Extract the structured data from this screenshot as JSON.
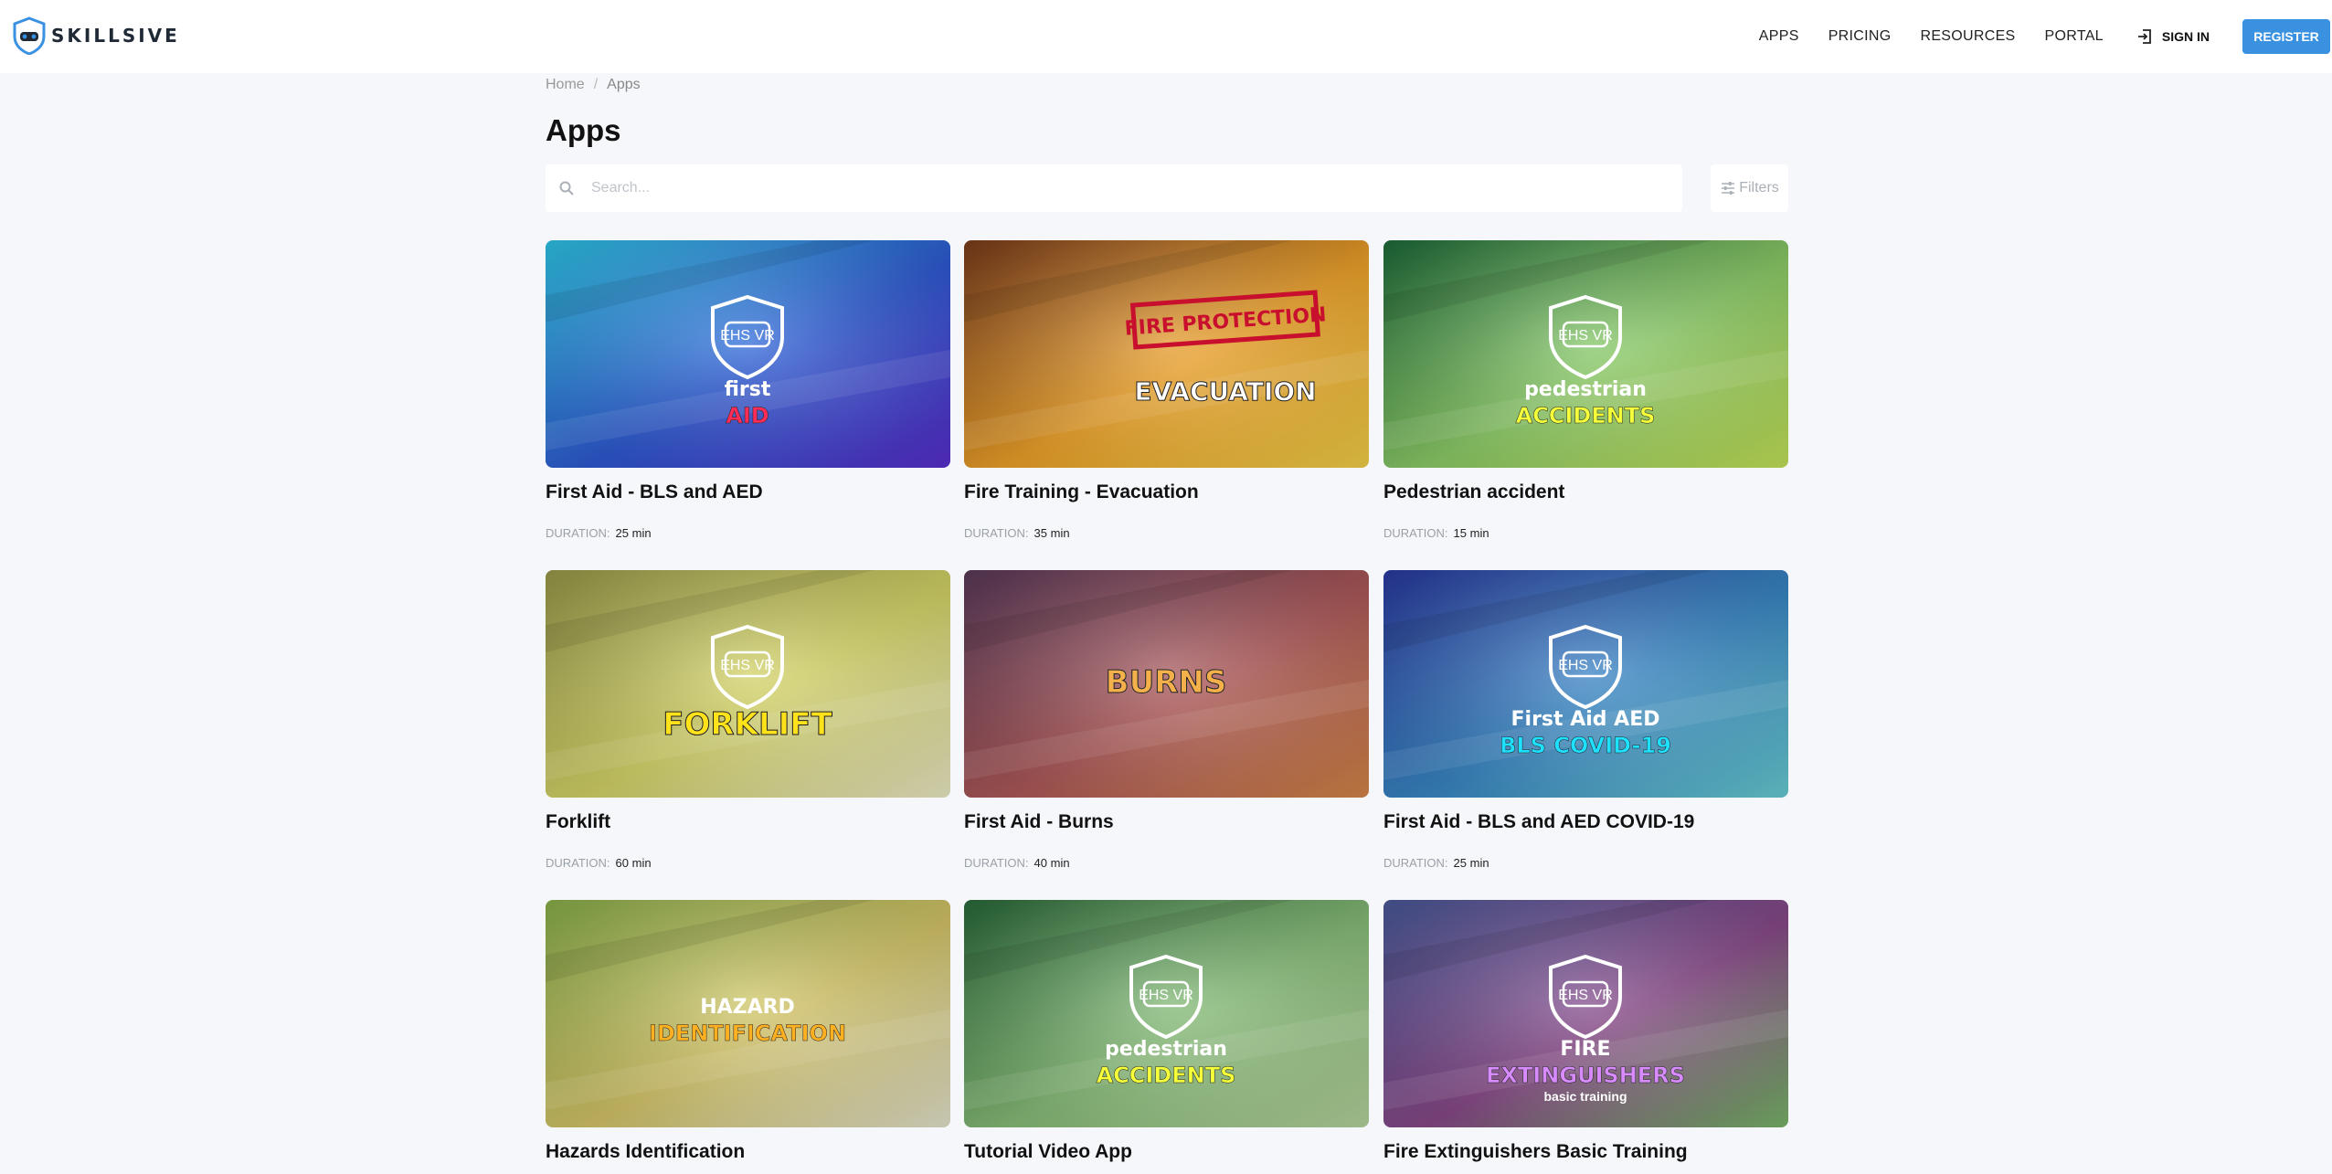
{
  "brand": {
    "name": "SKILLSIVE",
    "accent": "#3a91e0"
  },
  "nav": {
    "items": [
      {
        "label": "APPS"
      },
      {
        "label": "PRICING"
      },
      {
        "label": "RESOURCES"
      },
      {
        "label": "PORTAL"
      }
    ],
    "signin_label": "SIGN IN",
    "register_label": "REGISTER"
  },
  "breadcrumb": {
    "home": "Home",
    "separator": "/",
    "current": "Apps"
  },
  "page": {
    "title": "Apps"
  },
  "search": {
    "placeholder": "Search...",
    "value": ""
  },
  "filters": {
    "label": "Filters"
  },
  "duration_label": "DURATION:",
  "apps": [
    {
      "title": "First Aid - BLS and AED",
      "duration": "25 min",
      "image": {
        "badge": "EHS VR",
        "line1": "first",
        "line2": "AID",
        "palette": [
          "#2ec5e8",
          "#2f5bd6",
          "#5a2fd0"
        ],
        "text_color": "#ff2d55"
      }
    },
    {
      "title": "Fire Training - Evacuation",
      "duration": "35 min",
      "image": {
        "stamp": "FIRE PROTECTION",
        "line2": "EVACUATION",
        "palette": [
          "#7a3c1c",
          "#f2a52a",
          "#f7d34a"
        ]
      }
    },
    {
      "title": "Pedestrian accident",
      "duration": "15 min",
      "image": {
        "badge": "EHS VR",
        "line1": "pedestrian",
        "line2": "ACCIDENTS",
        "palette": [
          "#1e6b3a",
          "#8fd06a",
          "#c6e65a"
        ],
        "text_color": "#f5ff3a"
      }
    },
    {
      "title": "Forklift",
      "duration": "60 min",
      "image": {
        "badge": "EHS VR",
        "line2": "FORKLIFT",
        "palette": [
          "#9a9a4a",
          "#d8d86a",
          "#f0eec8"
        ],
        "text_color": "#ffe21a"
      }
    },
    {
      "title": "First Aid - Burns",
      "duration": "40 min",
      "image": {
        "line2": "BURNS",
        "palette": [
          "#5a3a5a",
          "#b05a5a",
          "#d9884a"
        ],
        "text_color": "#f4b04a"
      }
    },
    {
      "title": "First Aid - BLS and AED COVID-19",
      "duration": "25 min",
      "image": {
        "badge": "EHS VR",
        "line1": "First Aid AED",
        "line2": "BLS COVID-19",
        "palette": [
          "#2a3aa0",
          "#3a8ac8",
          "#6ad0d8"
        ],
        "text_color": "#1ee0ff"
      }
    },
    {
      "title": "Hazards Identification",
      "duration": "",
      "image": {
        "line1": "HAZARD",
        "line2": "IDENTIFICATION",
        "palette": [
          "#8ab04a",
          "#d8c86a",
          "#e8e8d0"
        ],
        "text_color": "#ffb020"
      }
    },
    {
      "title": "Tutorial Video App",
      "duration": "",
      "image": {
        "badge": "EHS VR",
        "line1": "pedestrian",
        "line2": "ACCIDENTS",
        "palette": [
          "#2a6a3a",
          "#8ac07a",
          "#b8d8a0"
        ],
        "text_color": "#f5ff3a"
      }
    },
    {
      "title": "Fire Extinguishers Basic Training",
      "duration": "",
      "image": {
        "badge": "EHS VR",
        "line1": "FIRE",
        "line2": "EXTINGUISHERS",
        "line3": "basic training",
        "palette": [
          "#4a5a9a",
          "#8a4a8a",
          "#7ab86a"
        ],
        "text_color": "#d88aff"
      }
    }
  ]
}
